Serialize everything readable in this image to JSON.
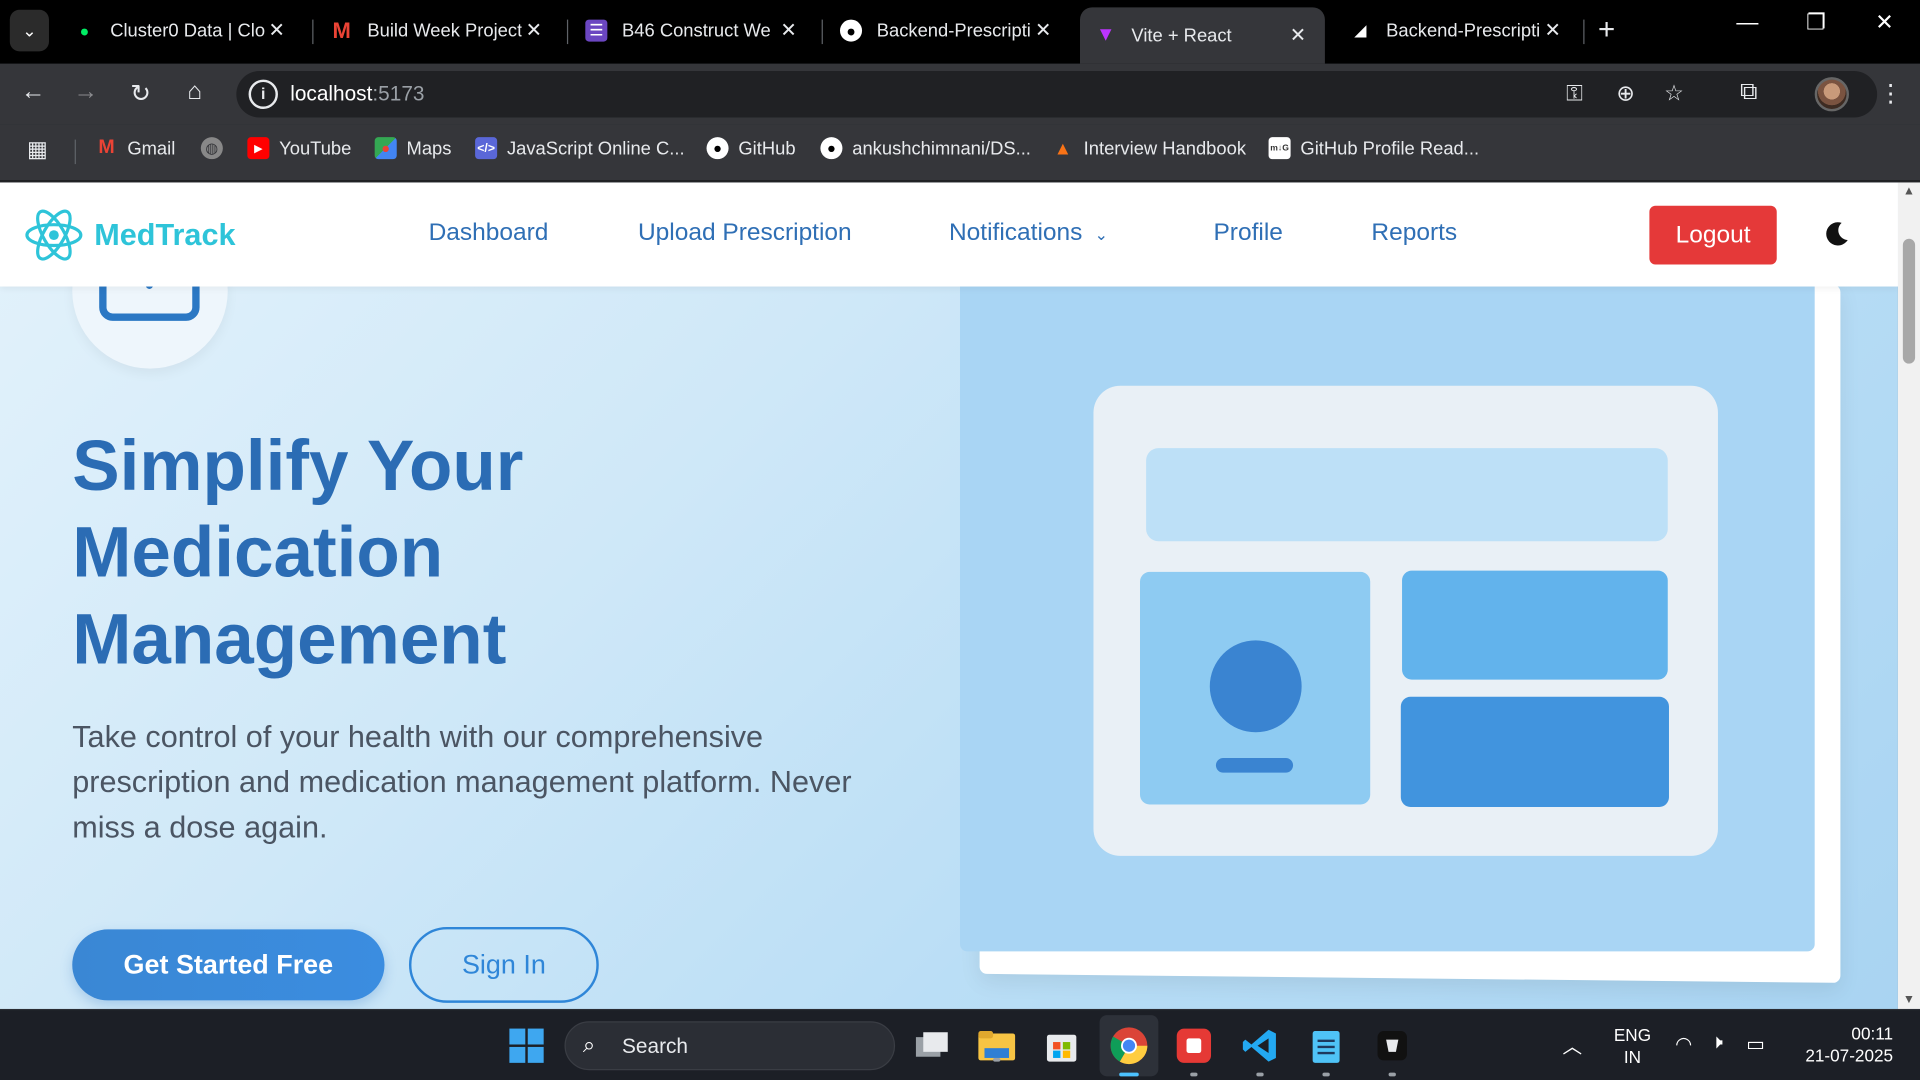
{
  "browser": {
    "tabs": [
      {
        "label": "Cluster0 Data | Clo",
        "icon": "mongodb-leaf-icon",
        "active": false
      },
      {
        "label": "Build Week Project",
        "icon": "gmail-icon",
        "active": false
      },
      {
        "label": "B46 Construct We",
        "icon": "list-doc-icon",
        "active": false
      },
      {
        "label": "Backend-Prescripti",
        "icon": "github-icon",
        "active": false
      },
      {
        "label": "Vite + React",
        "icon": "vite-icon",
        "active": true
      },
      {
        "label": "Backend-Prescripti",
        "icon": "render-icon",
        "active": false
      }
    ],
    "url_host": "localhost",
    "url_port": ":5173",
    "bookmarks": [
      {
        "label": "Gmail",
        "icon": "gmail-icon"
      },
      {
        "label": "",
        "icon": "globe-icon"
      },
      {
        "label": "YouTube",
        "icon": "youtube-icon"
      },
      {
        "label": "Maps",
        "icon": "maps-icon"
      },
      {
        "label": "JavaScript Online C...",
        "icon": "code-icon"
      },
      {
        "label": "GitHub",
        "icon": "github-icon"
      },
      {
        "label": "ankushchimnani/DS...",
        "icon": "github-icon"
      },
      {
        "label": "Interview Handbook",
        "icon": "cone-icon"
      },
      {
        "label": "GitHub Profile Read...",
        "icon": "readme-icon"
      }
    ]
  },
  "app": {
    "brand": "MedTrack",
    "nav": {
      "dashboard": "Dashboard",
      "upload": "Upload Prescription",
      "notifications": "Notifications",
      "profile": "Profile",
      "reports": "Reports"
    },
    "logout": "Logout",
    "hero": {
      "title_line1": "Simplify Your",
      "title_line2": "Medication",
      "title_line3": "Management",
      "subtitle": "Take control of your health with our comprehensive prescription and medication management platform. Never miss a dose again.",
      "cta_primary": "Get Started Free",
      "cta_secondary": "Sign In"
    },
    "colors": {
      "brand": "#2ec4d9",
      "nav_link": "#2f6fb5",
      "logout": "#e53939",
      "hero_title": "#2b6cb4"
    }
  },
  "taskbar": {
    "search_placeholder": "Search",
    "language_line1": "ENG",
    "language_line2": "IN",
    "time": "00:11",
    "date": "21-07-2025"
  }
}
